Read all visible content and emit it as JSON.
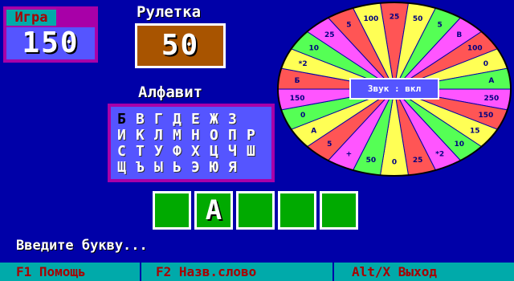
{
  "player": {
    "name": "Игра",
    "score": "150"
  },
  "roulette": {
    "title": "Рулетка",
    "value": "50"
  },
  "alphabet": {
    "title": "Алфавит",
    "rows": [
      [
        "Б",
        "В",
        "Г",
        "Д",
        "Е",
        "Ж",
        "З"
      ],
      [
        "И",
        "К",
        "Л",
        "М",
        "Н",
        "О",
        "П",
        "Р"
      ],
      [
        "С",
        "Т",
        "У",
        "Ф",
        "Х",
        "Ц",
        "Ч",
        "Ш"
      ],
      [
        "Щ",
        "Ъ",
        "Ы",
        "Ь",
        "Э",
        "Ю",
        "Я"
      ]
    ],
    "used": [
      "Б"
    ]
  },
  "word": {
    "cells": [
      "",
      "А",
      "",
      "",
      ""
    ]
  },
  "prompt": "Введите букву...",
  "wheel": {
    "sound_button": "Звук : вкл",
    "sectors": [
      "25",
      "50",
      "5",
      "В",
      "100",
      "0",
      "А",
      "250",
      "150",
      "15",
      "10",
      "*2",
      "25",
      "0",
      "50",
      "+",
      "5",
      "А",
      "0",
      "150",
      "Б",
      "*2",
      "10",
      "25",
      "5",
      "100"
    ],
    "colors": [
      "#ff5555",
      "#ffff55",
      "#55ff55",
      "#ff55ff"
    ]
  },
  "fkeys": {
    "help": "F1 Помощь",
    "name_word": "F2 Назв.слово",
    "exit": "Alt/X Выход"
  }
}
